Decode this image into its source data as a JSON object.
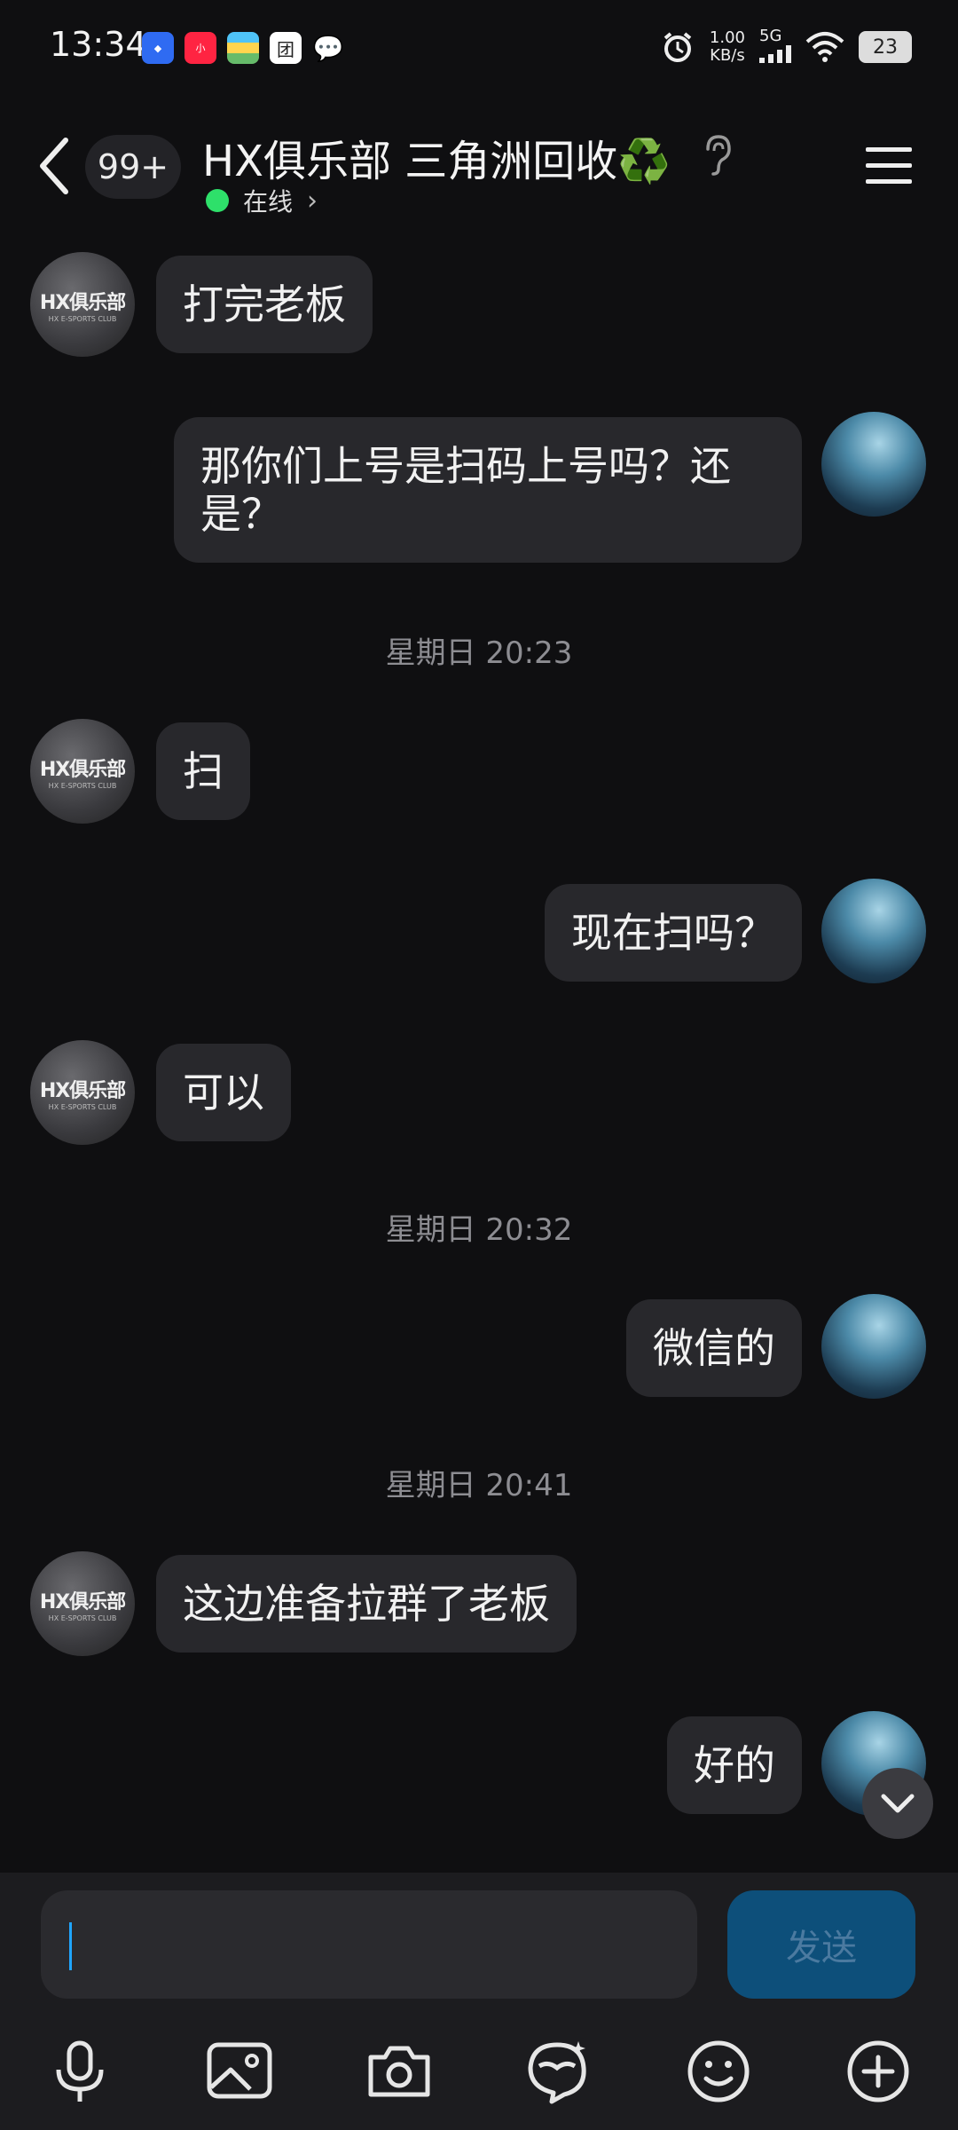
{
  "status_bar": {
    "time": "13:34",
    "apps": [
      "blue-app-icon",
      "xiaohongshu-icon",
      "wallet-icon",
      "meituan-icon",
      "wechat-icon"
    ],
    "speed_value": "1.00",
    "speed_unit": "KB/s",
    "network": "5G",
    "battery": "23"
  },
  "header": {
    "unread_badge": "99+",
    "title": "HX俱乐部 三角洲回收♻️",
    "online_status": "在线",
    "online_color": "#2ee06a"
  },
  "messages": [
    {
      "from": "other",
      "text": "打完老板"
    },
    {
      "from": "me",
      "text": "那你们上号是扫码上号吗？还是？"
    },
    {
      "timestamp": "星期日 20:23"
    },
    {
      "from": "other",
      "text": "扫"
    },
    {
      "from": "me",
      "text": "现在扫吗？"
    },
    {
      "from": "other",
      "text": "可以"
    },
    {
      "timestamp": "星期日 20:32"
    },
    {
      "from": "me",
      "text": "微信的"
    },
    {
      "timestamp": "星期日 20:41"
    },
    {
      "from": "other",
      "text": "这边准备拉群了老板"
    },
    {
      "from": "me",
      "text": "好的"
    }
  ],
  "club_avatar": {
    "logo_text": "HX俱乐部",
    "logo_sub": "HX E-SPORTS CLUB"
  },
  "input": {
    "value": "",
    "send_label": "发送"
  },
  "toolbar": [
    "mic-icon",
    "image-icon",
    "camera-icon",
    "sticker-icon",
    "emoji-icon",
    "plus-icon"
  ]
}
